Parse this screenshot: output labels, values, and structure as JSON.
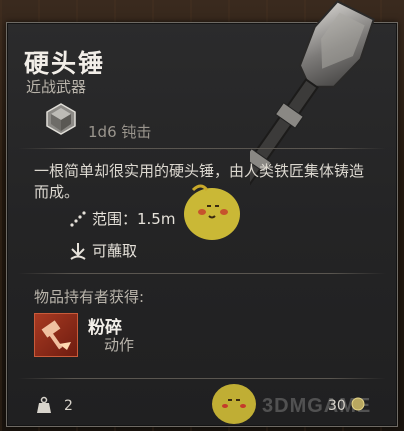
{
  "item": {
    "name": "硬头锤",
    "category": "近战武器",
    "damage": "1d6 钝击",
    "description": "一根简单却很实用的硬头锤，由人类铁匠集体铸造而成。",
    "properties": [
      {
        "icon": "range-icon",
        "label": "范围：1.5m"
      },
      {
        "icon": "dip-icon",
        "label": "可蘸取"
      }
    ],
    "holder_grants_label": "物品持有者获得:",
    "ability": {
      "name": "粉碎",
      "type": "动作",
      "icon": "smash-action-icon"
    },
    "weight": "2",
    "price": "30"
  },
  "watermark": "3DMGAME",
  "colors": {
    "panel": "#262627",
    "border": "#6e6a64",
    "text": "#dcd8d0",
    "ability_accent": "#a83a22"
  }
}
